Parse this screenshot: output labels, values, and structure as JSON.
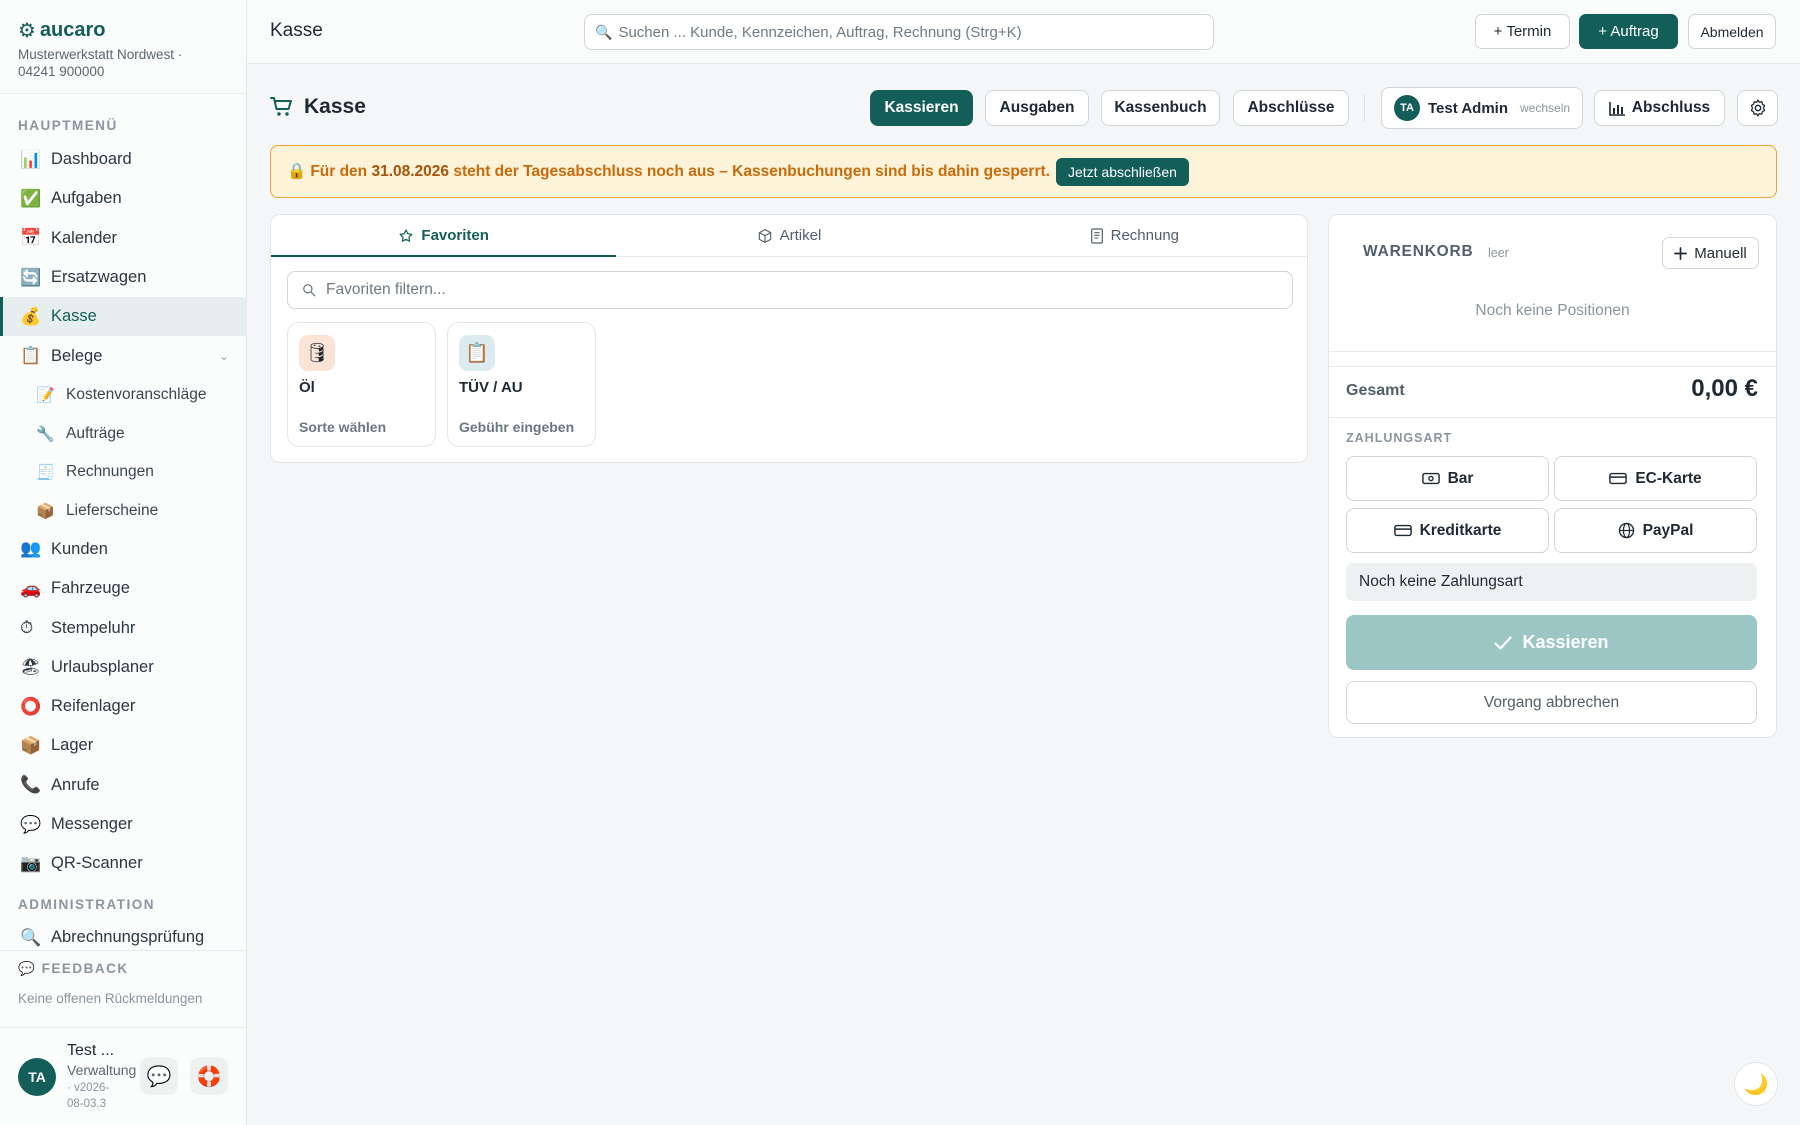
{
  "brand": {
    "name": "aucaro",
    "logo_icon": "gear-icon",
    "subtitle_line1": "Musterwerkstatt Nordwest ·",
    "subtitle_line2": "04241 900000"
  },
  "sidebar": {
    "main_label": "HAUPTMENÜ",
    "items": [
      {
        "label": "Dashboard",
        "icon": "📊"
      },
      {
        "label": "Aufgaben",
        "icon": "✅"
      },
      {
        "label": "Kalender",
        "icon": "📅"
      },
      {
        "label": "Ersatzwagen",
        "icon": "🔄"
      },
      {
        "label": "Kasse",
        "icon": "💰"
      },
      {
        "label": "Belege",
        "icon": "📋"
      },
      {
        "label": "Kostenvoranschläge",
        "icon": "📝"
      },
      {
        "label": "Aufträge",
        "icon": "🔧"
      },
      {
        "label": "Rechnungen",
        "icon": "🧾"
      },
      {
        "label": "Lieferscheine",
        "icon": "📦"
      },
      {
        "label": "Kunden",
        "icon": "👥"
      },
      {
        "label": "Fahrzeuge",
        "icon": "🚗"
      },
      {
        "label": "Stempeluhr",
        "icon": "⏱"
      },
      {
        "label": "Urlaubsplaner",
        "icon": "🏖"
      },
      {
        "label": "Reifenlager",
        "icon": "⭕"
      },
      {
        "label": "Lager",
        "icon": "📦"
      },
      {
        "label": "Anrufe",
        "icon": "📞"
      },
      {
        "label": "Messenger",
        "icon": "💬"
      },
      {
        "label": "QR-Scanner",
        "icon": "📷"
      }
    ],
    "admin_label": "ADMINISTRATION",
    "admin_items": [
      {
        "label": "Abrechnungsprüfung",
        "icon": "🔍"
      }
    ],
    "feedback_title": "FEEDBACK",
    "feedback_icon": "💬",
    "feedback_text": "Keine offenen Rückmeldungen",
    "user": {
      "initials": "TA",
      "name": "Test ...",
      "role": "Verwaltung",
      "version": "· v2026-08-03.3",
      "chat_icon": "💬",
      "help_icon": "🛟"
    }
  },
  "topbar": {
    "title": "Kasse",
    "search_placeholder": "Suchen ... Kunde, Kennzeichen, Auftrag, Rechnung (Strg+K)",
    "termin_label": "+ Termin",
    "auftrag_label": "+ Auftrag",
    "logout_label": "Abmelden"
  },
  "page": {
    "title": "Kasse",
    "buttons": {
      "kassieren": "Kassieren",
      "ausgaben": "Ausgaben",
      "kassenbuch": "Kassenbuch",
      "abschluesse": "Abschlüsse",
      "abschluss": "Abschluss"
    },
    "user_chip": {
      "initials": "TA",
      "name": "Test Admin",
      "switch": "wechseln"
    }
  },
  "banner": {
    "icon": "🔒",
    "prefix": "Für den ",
    "date": "31.08.2026",
    "suffix": " steht der Tagesabschluss noch aus – Kassenbuchungen sind bis dahin gesperrt.",
    "button": "Jetzt abschließen"
  },
  "favorites": {
    "tabs": [
      "Favoriten",
      "Artikel",
      "Rechnung"
    ],
    "filter_placeholder": "Favoriten filtern...",
    "tiles": [
      {
        "icon": "🛢",
        "title": "Öl",
        "subtitle": "Sorte wählen",
        "bg": "#fbe3d6"
      },
      {
        "icon": "📋",
        "title": "TÜV / AU",
        "subtitle": "Gebühr eingeben",
        "bg": "#dcebf0"
      }
    ]
  },
  "cart": {
    "title": "WARENKORB",
    "status": "leer",
    "manual_label": "Manuell",
    "empty_text": "Noch keine Positionen",
    "total_label": "Gesamt",
    "total_value": "0,00 €",
    "payment_label": "ZAHLUNGSART",
    "payment_methods": [
      "Bar",
      "EC-Karte",
      "Kreditkarte",
      "PayPal"
    ],
    "payment_status": "Noch keine Zahlungsart",
    "checkout_label": "Kassieren",
    "cancel_label": "Vorgang abbrechen"
  },
  "theme_toggle_icon": "🌙",
  "colors": {
    "accent": "#135e58",
    "warning": "#e8a23c",
    "warning_bg": "#fdf3d8"
  }
}
